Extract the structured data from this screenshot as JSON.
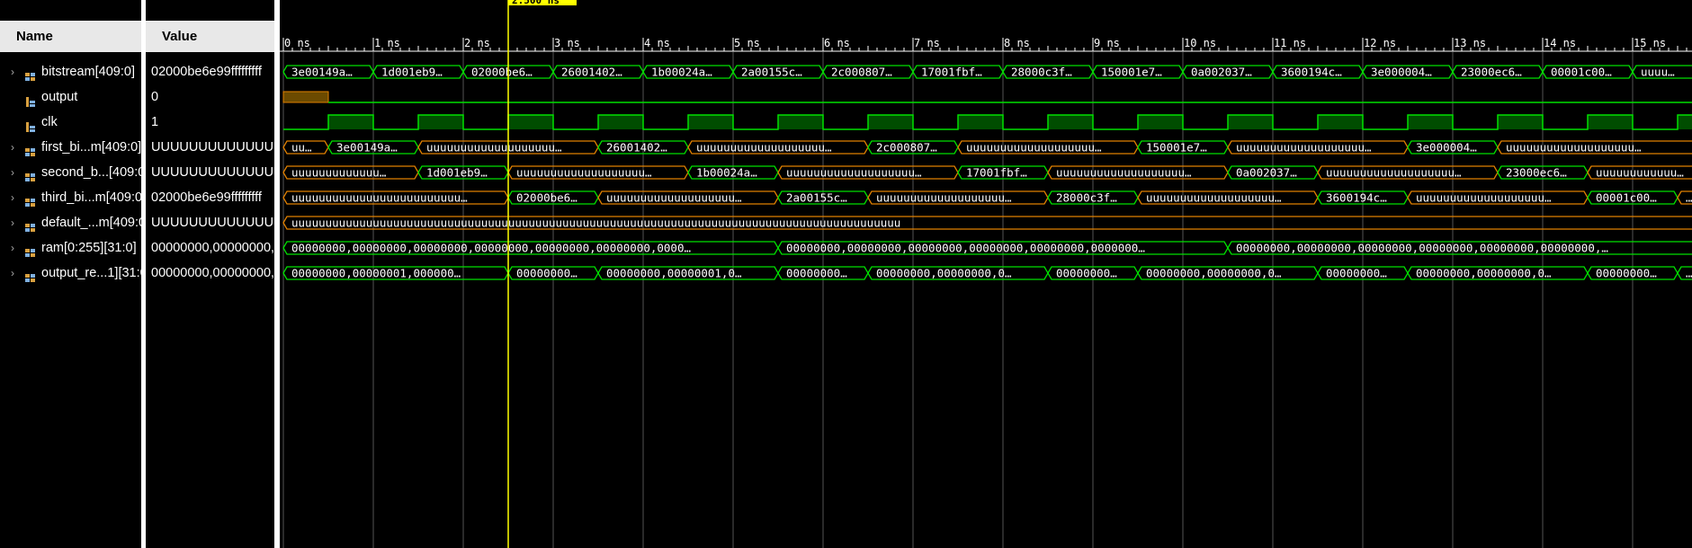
{
  "columns": {
    "name": "Name",
    "value": "Value"
  },
  "cursor_label": "2.500 ns",
  "timeline": {
    "labels": [
      "0 ns",
      "1 ns",
      "2 ns",
      "3 ns",
      "4 ns",
      "5 ns",
      "6 ns",
      "7 ns",
      "8 ns",
      "9 ns",
      "10 ns",
      "11 ns",
      "12 ns",
      "13 ns",
      "14 ns",
      "15 ns"
    ]
  },
  "signals": [
    {
      "name": "bitstream[409:0]",
      "value": "02000be6e99fffffffff",
      "icon": "bus-icon",
      "expandable": true
    },
    {
      "name": "output",
      "value": "0",
      "icon": "bit-icon",
      "expandable": false
    },
    {
      "name": "clk",
      "value": "1",
      "icon": "bit-icon",
      "expandable": false
    },
    {
      "name": "first_bi...m[409:0]",
      "value": "UUUUUUUUUUUUUUU",
      "icon": "bus-icon",
      "expandable": true
    },
    {
      "name": "second_b...[409:0]",
      "value": "UUUUUUUUUUUUUUU",
      "icon": "bus-icon",
      "expandable": true
    },
    {
      "name": "third_bi...m[409:0]",
      "value": "02000be6e99fffffffff",
      "icon": "bus-icon",
      "expandable": true
    },
    {
      "name": "default_...m[409:0]",
      "value": "UUUUUUUUUUUUUUU",
      "icon": "bus-icon",
      "expandable": true
    },
    {
      "name": "ram[0:255][31:0]",
      "value": "00000000,00000000,0",
      "icon": "bus-icon",
      "expandable": true
    },
    {
      "name": "output_re...1][31:0]",
      "value": "00000000,00000000,0",
      "icon": "bus-icon",
      "expandable": true
    }
  ],
  "waves": {
    "bitstream": [
      "3e00149a…",
      "1d001eb9…",
      "02000be6…",
      "26001402…",
      "1b00024a…",
      "2a00155c…",
      "2c000807…",
      "17001fbf…",
      "28000c3f…",
      "150001e7…",
      "0a002037…",
      "3600194c…",
      "3e000004…",
      "23000ec6…",
      "00001c00…",
      "uuuu…"
    ],
    "first": [
      {
        "t": "uu…",
        "c": "orange"
      },
      {
        "t": "3e00149a…",
        "c": "green"
      },
      {
        "t": "uuuuuuuuuuuuuuuuuuu…",
        "c": "orange"
      },
      {
        "t": "26001402…",
        "c": "green"
      },
      {
        "t": "uuuuuuuuuuuuuuuuuuu…",
        "c": "orange"
      },
      {
        "t": "2c000807…",
        "c": "green"
      },
      {
        "t": "uuuuuuuuuuuuuuuuuuu…",
        "c": "orange"
      },
      {
        "t": "150001e7…",
        "c": "green"
      },
      {
        "t": "uuuuuuuuuuuuuuuuuuu…",
        "c": "orange"
      },
      {
        "t": "3e000004…",
        "c": "green"
      },
      {
        "t": "uuuuuuuuuuuuuuuuuuu…",
        "c": "orange"
      }
    ],
    "second": [
      {
        "t": "uuuuuuuuuuuuu…",
        "c": "orange"
      },
      {
        "t": "1d001eb9…",
        "c": "green"
      },
      {
        "t": "uuuuuuuuuuuuuuuuuuu…",
        "c": "orange"
      },
      {
        "t": "1b00024a…",
        "c": "green"
      },
      {
        "t": "uuuuuuuuuuuuuuuuuuu…",
        "c": "orange"
      },
      {
        "t": "17001fbf…",
        "c": "green"
      },
      {
        "t": "uuuuuuuuuuuuuuuuuuu…",
        "c": "orange"
      },
      {
        "t": "0a002037…",
        "c": "green"
      },
      {
        "t": "uuuuuuuuuuuuuuuuuuu…",
        "c": "orange"
      },
      {
        "t": "23000ec6…",
        "c": "green"
      },
      {
        "t": "uuuuuuuuuuuu…",
        "c": "orange"
      }
    ],
    "third": [
      {
        "t": "uuuuuuuuuuuuuuuuuuuuuuuuu…",
        "c": "orange"
      },
      {
        "t": "02000be6…",
        "c": "green"
      },
      {
        "t": "uuuuuuuuuuuuuuuuuuu…",
        "c": "orange"
      },
      {
        "t": "2a00155c…",
        "c": "green"
      },
      {
        "t": "uuuuuuuuuuuuuuuuuuu…",
        "c": "orange"
      },
      {
        "t": "28000c3f…",
        "c": "green"
      },
      {
        "t": "uuuuuuuuuuuuuuuuuuu…",
        "c": "orange"
      },
      {
        "t": "3600194c…",
        "c": "green"
      },
      {
        "t": "uuuuuuuuuuuuuuuuuuu…",
        "c": "orange"
      },
      {
        "t": "00001c00…",
        "c": "green"
      },
      {
        "t": "…",
        "c": "orange"
      }
    ],
    "default": "uuuuuuuuuuuuuuuuuuuuuuuuuuuuuuuuuuuuuuuuuuuuuuuuuuuuuuuuuuuuuuuuuuuuuuuuuuuuuuuuuuuuuuuuuu",
    "ram": [
      "00000000,00000000,00000000,00000000,00000000,00000000,0000…",
      "00000000,00000000,00000000,00000000,00000000,0000000…",
      "00000000,00000000,00000000,00000000,00000000,00000000,…"
    ],
    "output_reg": [
      "00000000,00000001,000000…",
      "00000000…",
      "00000000,00000001,0…",
      "00000000…",
      "00000000,00000000,0…",
      "00000000…",
      "00000000,00000000,0…",
      "00000000…",
      "00000000,00000000,0…",
      "00000000…",
      "…"
    ]
  },
  "colors": {
    "green": "#00e000",
    "orange": "#e08000",
    "cursor": "#ffff00",
    "grid": "#555555",
    "text": "#ffffff"
  }
}
